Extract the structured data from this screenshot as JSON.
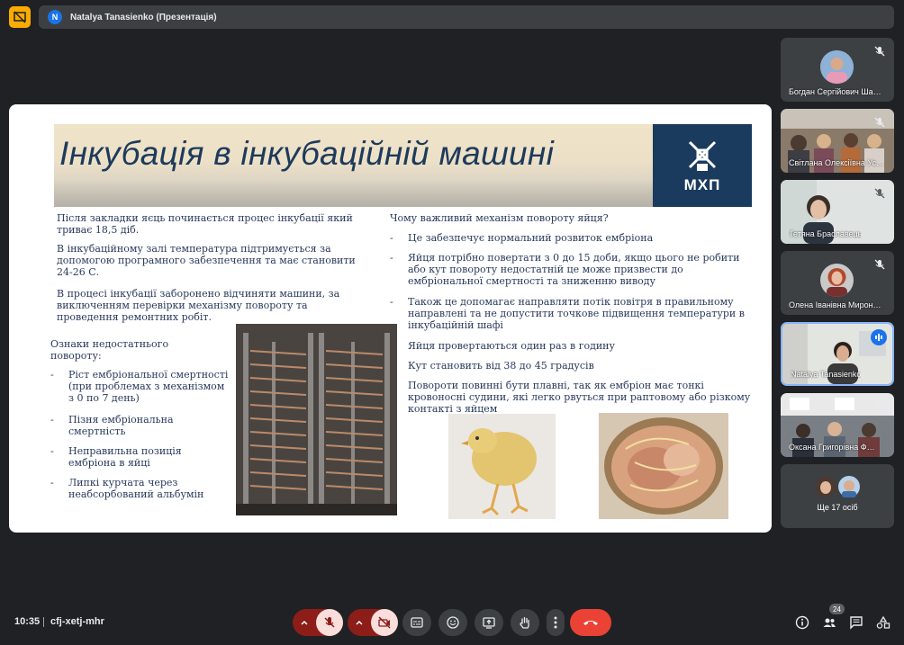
{
  "header": {
    "avatar_letter": "N",
    "title": "Natalya Tanasienko (Презентація)"
  },
  "slide": {
    "title": "Інкубація в інкубаційній машині",
    "logo_text": "МХП",
    "left": {
      "p1": "Після закладки яєць починається процес інкубації який триває 18,5 діб.",
      "p2": "В інкубаційному залі температура підтримується за допомогою програмного забезпечення та має становити 24-26 С.",
      "p3": "В процесі інкубації заборонено відчиняти машини, за виключенням перевірки механізму повороту та проведення ремонтних робіт.",
      "signs_title": "Ознаки недостатнього повороту:",
      "signs": [
        "Ріст ембріональної смертності (при проблемах з механізмом з 0 по 7 день)",
        "Пізня ембріональна смертність",
        "Неправильна позиція ембріона в яйці",
        "Липкі курчата через неабсорбований альбумін"
      ]
    },
    "right": {
      "question": "Чому важливий механізм повороту яйця?",
      "reasons": [
        "Це забезпечує нормальний розвиток ембріона",
        "Яйця потрібно повертати з 0 до 15 доби, якщо цього не робити або кут повороту недостатній це може призвести до ембріональної смертності та зниженню виводу",
        "Також це допомагає направляти потік повітря в правильному направлені та не допустити точкове підвищення температури в інкубаційній шафі"
      ],
      "p_once": "Яйця провертаються один раз в годину",
      "p_angle": "Кут становить від 38 до 45 градусів",
      "p_smooth": "Повороти повинні бути плавні, так як ембріон має тонкі кровоносні судини, які легко рвуться при раптовому або різкому контакті з яйцем"
    }
  },
  "participants": [
    {
      "name": "Богдан Сергійович Ша…"
    },
    {
      "name": "Світлана Олексіївна Ус…"
    },
    {
      "name": "Тетяна Браславець"
    },
    {
      "name": "Олена Іванівна Мирон…"
    },
    {
      "name": "Natalya Tanasienko"
    },
    {
      "name": "Оксана Григорівна Ф…"
    }
  ],
  "more_participants": "Ще 17 осіб",
  "bottom": {
    "time": "10:35",
    "meeting_code": "cfj-xetj-mhr",
    "people_count": "24"
  },
  "colors": {
    "accent": "#8ab4f8",
    "leave": "#ea4335",
    "muted_pill": "#f9dedc",
    "logo_bg": "#1b3b5e"
  }
}
